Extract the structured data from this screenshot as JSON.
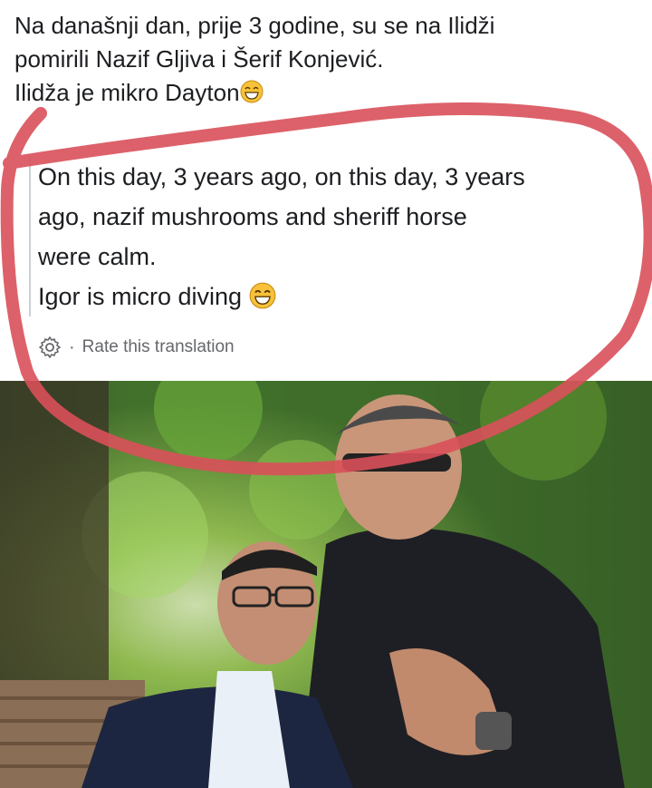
{
  "post": {
    "lines": [
      "Na današnji dan, prije 3 godine, su se na Ilidži",
      "pomirili Nazif Gljiva i Šerif Konjević.",
      "Ilidža je mikro Dayton"
    ],
    "emoji": "grinning-face-emoji"
  },
  "translation": {
    "lines": [
      "On this day, 3 years ago, on this day, 3 years",
      "ago, nazif mushrooms and sheriff horse",
      "were calm.",
      "Igor is micro diving"
    ],
    "emoji": "grinning-face-emoji",
    "settings_icon": "gear-icon",
    "separator": "·",
    "rate_label": "Rate this translation"
  },
  "annotation": {
    "color": "#d9505a"
  },
  "photo": {
    "subject": "two men posing outdoors under green trees"
  }
}
